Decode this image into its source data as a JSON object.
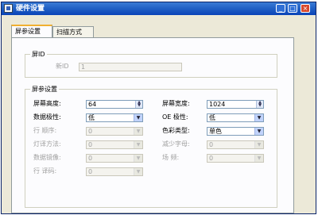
{
  "window": {
    "title": "硬件设置"
  },
  "tabs": [
    {
      "label": "屏参设置"
    },
    {
      "label": "扫描方式"
    }
  ],
  "id_group": {
    "legend": "屏ID",
    "id_label": "新ID",
    "id_value": "1"
  },
  "params_group": {
    "legend": "屏参设置",
    "rows": [
      {
        "left_label": "屏幕高度:",
        "left_value": "64",
        "right_label": "屏幕宽度:",
        "right_value": "1024"
      },
      {
        "left_label": "数据极性:",
        "left_value": "低",
        "right_label": "OE 极性:",
        "right_value": "低"
      },
      {
        "left_label": "行  顺序:",
        "left_value": "0",
        "right_label": "色彩类型:",
        "right_value": "单色"
      },
      {
        "left_label": "灯译方法:",
        "left_value": "0",
        "right_label": "减少字母:",
        "right_value": "0"
      },
      {
        "left_label": "数据镜像:",
        "left_value": "0",
        "right_label": "场  频:",
        "right_value": "0"
      },
      {
        "left_label": "行  译码:",
        "left_value": "0"
      }
    ]
  }
}
